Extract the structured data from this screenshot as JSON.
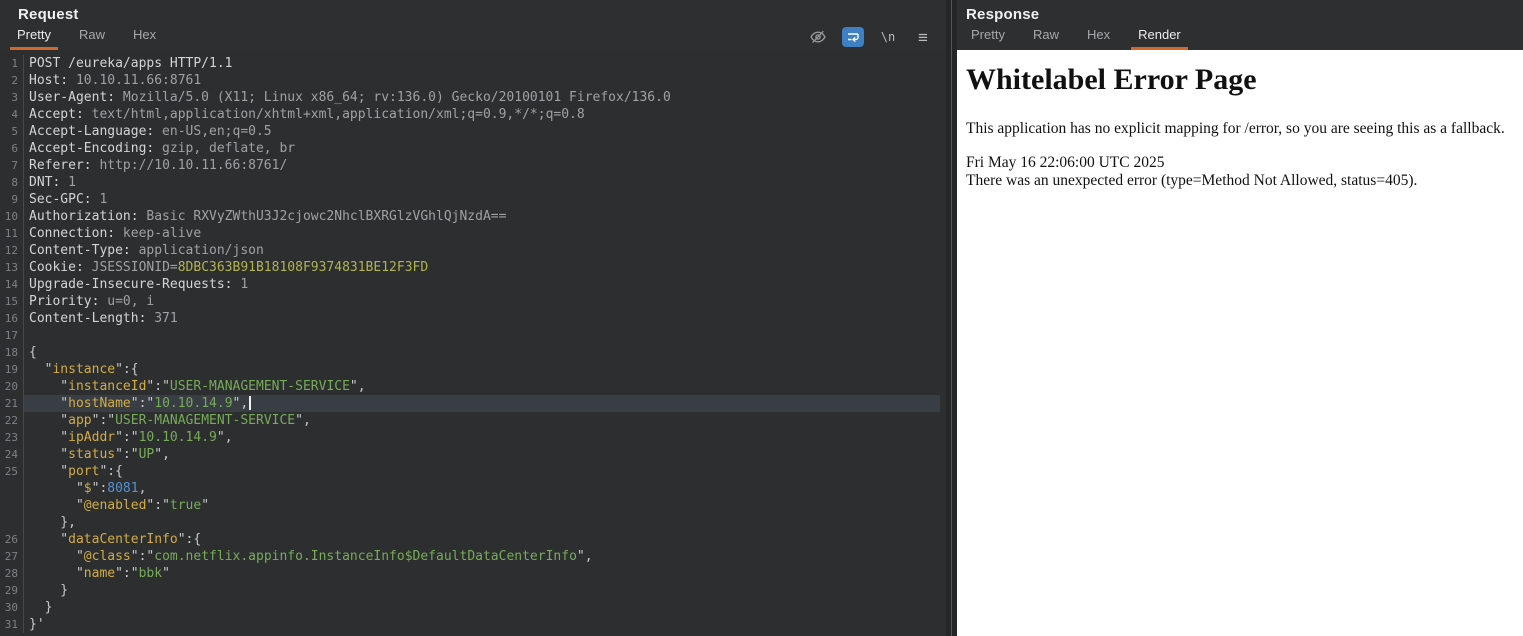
{
  "request_panel": {
    "title": "Request",
    "tabs": [
      {
        "label": "Pretty",
        "active": true
      },
      {
        "label": "Raw",
        "active": false
      },
      {
        "label": "Hex",
        "active": false
      }
    ],
    "toolbar": {
      "newline_label": "\\n",
      "menu_label": "≡"
    },
    "code_lines": [
      {
        "n": "1",
        "segs": [
          [
            "h",
            "POST /eureka/apps HTTP/1.1"
          ]
        ]
      },
      {
        "n": "2",
        "segs": [
          [
            "h",
            "Host:"
          ],
          [
            "v",
            " 10.10.11.66:8761"
          ]
        ]
      },
      {
        "n": "3",
        "segs": [
          [
            "h",
            "User-Agent:"
          ],
          [
            "v",
            " Mozilla/5.0 (X11; Linux x86_64; rv:136.0) Gecko/20100101 Firefox/136.0"
          ]
        ]
      },
      {
        "n": "4",
        "segs": [
          [
            "h",
            "Accept:"
          ],
          [
            "v",
            " text/html,application/xhtml+xml,application/xml;q=0.9,*/*;q=0.8"
          ]
        ]
      },
      {
        "n": "5",
        "segs": [
          [
            "h",
            "Accept-Language:"
          ],
          [
            "v",
            " en-US,en;q=0.5"
          ]
        ]
      },
      {
        "n": "6",
        "segs": [
          [
            "h",
            "Accept-Encoding:"
          ],
          [
            "v",
            " gzip, deflate, br"
          ]
        ]
      },
      {
        "n": "7",
        "segs": [
          [
            "h",
            "Referer:"
          ],
          [
            "v",
            " http://10.10.11.66:8761/"
          ]
        ]
      },
      {
        "n": "8",
        "segs": [
          [
            "h",
            "DNT:"
          ],
          [
            "v",
            " 1"
          ]
        ]
      },
      {
        "n": "9",
        "segs": [
          [
            "h",
            "Sec-GPC:"
          ],
          [
            "v",
            " 1"
          ]
        ]
      },
      {
        "n": "10",
        "segs": [
          [
            "h",
            "Authorization:"
          ],
          [
            "v",
            " Basic RXVyZWthU3J2cjowc2NhclBXRGlzVGhlQjNzdA=="
          ]
        ]
      },
      {
        "n": "11",
        "underline": true,
        "segs": [
          [
            "h",
            "Connection:"
          ],
          [
            "v",
            " keep-alive"
          ]
        ]
      },
      {
        "n": "12",
        "segs": [
          [
            "h",
            "Content-Type:"
          ],
          [
            "v",
            " application/json"
          ]
        ]
      },
      {
        "n": "13",
        "segs": [
          [
            "h",
            "Cookie:"
          ],
          [
            "v",
            " JSESSIONID="
          ],
          [
            "c",
            "8DBC363B91B18108F9374831BE12F3FD"
          ]
        ]
      },
      {
        "n": "14",
        "segs": [
          [
            "h",
            "Upgrade-Insecure-Requests:"
          ],
          [
            "v",
            " 1"
          ]
        ]
      },
      {
        "n": "15",
        "segs": [
          [
            "h",
            "Priority:"
          ],
          [
            "v",
            " u=0, i"
          ]
        ]
      },
      {
        "n": "16",
        "segs": [
          [
            "h",
            "Content-Length:"
          ],
          [
            "v",
            " 371"
          ]
        ]
      },
      {
        "n": "17",
        "segs": []
      },
      {
        "n": "18",
        "segs": [
          [
            "p",
            "{"
          ]
        ]
      },
      {
        "n": "19",
        "segs": [
          [
            "p",
            "  \""
          ],
          [
            "k",
            "instance"
          ],
          [
            "p",
            "\":{"
          ]
        ]
      },
      {
        "n": "20",
        "segs": [
          [
            "p",
            "    \""
          ],
          [
            "k",
            "instanceId"
          ],
          [
            "p",
            "\":\""
          ],
          [
            "s",
            "USER-MANAGEMENT-SERVICE"
          ],
          [
            "p",
            "\","
          ]
        ]
      },
      {
        "n": "21",
        "hl": true,
        "caret": true,
        "segs": [
          [
            "p",
            "    \""
          ],
          [
            "k",
            "hostName"
          ],
          [
            "p",
            "\":\""
          ],
          [
            "s",
            "10.10.14.9"
          ],
          [
            "p",
            "\","
          ]
        ]
      },
      {
        "n": "22",
        "segs": [
          [
            "p",
            "    \""
          ],
          [
            "k",
            "app"
          ],
          [
            "p",
            "\":\""
          ],
          [
            "s",
            "USER-MANAGEMENT-SERVICE"
          ],
          [
            "p",
            "\","
          ]
        ]
      },
      {
        "n": "23",
        "segs": [
          [
            "p",
            "    \""
          ],
          [
            "k",
            "ipAddr"
          ],
          [
            "p",
            "\":\""
          ],
          [
            "s",
            "10.10.14.9"
          ],
          [
            "p",
            "\","
          ]
        ]
      },
      {
        "n": "24",
        "segs": [
          [
            "p",
            "    \""
          ],
          [
            "k",
            "status"
          ],
          [
            "p",
            "\":\""
          ],
          [
            "s",
            "UP"
          ],
          [
            "p",
            "\","
          ]
        ]
      },
      {
        "n": "25",
        "segs": [
          [
            "p",
            "    \""
          ],
          [
            "k",
            "port"
          ],
          [
            "p",
            "\":{"
          ]
        ]
      },
      {
        "n": "",
        "segs": [
          [
            "p",
            "      \""
          ],
          [
            "k",
            "$"
          ],
          [
            "p",
            "\":"
          ],
          [
            "n2",
            "8081"
          ],
          [
            "p",
            ","
          ]
        ]
      },
      {
        "n": "",
        "segs": [
          [
            "p",
            "      \""
          ],
          [
            "k",
            "@enabled"
          ],
          [
            "p",
            "\":\""
          ],
          [
            "s",
            "true"
          ],
          [
            "p",
            "\""
          ]
        ]
      },
      {
        "n": "",
        "segs": [
          [
            "p",
            "    },"
          ]
        ]
      },
      {
        "n": "26",
        "segs": [
          [
            "p",
            "    \""
          ],
          [
            "k",
            "dataCenterInfo"
          ],
          [
            "p",
            "\":{"
          ]
        ]
      },
      {
        "n": "27",
        "segs": [
          [
            "p",
            "      \""
          ],
          [
            "k",
            "@class"
          ],
          [
            "p",
            "\":\""
          ],
          [
            "s",
            "com.netflix.appinfo.InstanceInfo$DefaultDataCenterInfo"
          ],
          [
            "p",
            "\","
          ]
        ]
      },
      {
        "n": "28",
        "segs": [
          [
            "p",
            "      \""
          ],
          [
            "k",
            "name"
          ],
          [
            "p",
            "\":\""
          ],
          [
            "s",
            "bbk"
          ],
          [
            "p",
            "\""
          ]
        ]
      },
      {
        "n": "29",
        "segs": [
          [
            "p",
            "    }"
          ]
        ]
      },
      {
        "n": "30",
        "segs": [
          [
            "p",
            "  }"
          ]
        ]
      },
      {
        "n": "31",
        "segs": [
          [
            "p",
            "}'"
          ]
        ]
      }
    ]
  },
  "response_panel": {
    "title": "Response",
    "tabs": [
      {
        "label": "Pretty",
        "active": false
      },
      {
        "label": "Raw",
        "active": false
      },
      {
        "label": "Hex",
        "active": false
      },
      {
        "label": "Render",
        "active": true
      }
    ],
    "render": {
      "heading": "Whitelabel Error Page",
      "message": "This application has no explicit mapping for /error, so you are seeing this as a fallback.",
      "timestamp": "Fri May 16 22:06:00 UTC 2025",
      "error": "There was an unexpected error (type=Method Not Allowed, status=405)."
    }
  },
  "colors": {
    "accent_orange": "#d4682a",
    "wrap_button_blue": "#3f80c3",
    "json_key": "#d3ad43",
    "json_string": "#77ac58",
    "json_number": "#5292d4",
    "cookie_value": "#b3b44e",
    "editor_background": "#2c2e30",
    "current_line_highlight": "#383e44"
  }
}
